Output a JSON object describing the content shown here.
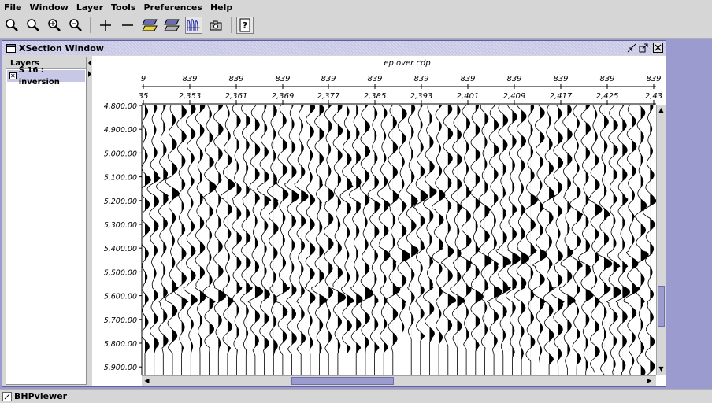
{
  "menubar": {
    "items": [
      "File",
      "Window",
      "Layer",
      "Tools",
      "Preferences",
      "Help"
    ]
  },
  "toolbar": {
    "buttons": [
      {
        "name": "zoom-reset-icon"
      },
      {
        "name": "zoom-icon"
      },
      {
        "name": "zoom-in-icon"
      },
      {
        "name": "zoom-out-icon"
      },
      {
        "name": "plus-icon"
      },
      {
        "name": "minus-icon"
      },
      {
        "name": "layer-yellow-icon"
      },
      {
        "name": "layer-gray-icon"
      },
      {
        "name": "wiggle-display-icon"
      },
      {
        "name": "camera-icon"
      },
      {
        "name": "help-icon",
        "label": "?"
      }
    ]
  },
  "xsection": {
    "title": "XSection Window",
    "layers_header": "Layers",
    "layer_item": "S 16 : inversion",
    "axis_title": "ep over cdp",
    "ep_labels": [
      "9",
      "839",
      "839",
      "839",
      "839",
      "839",
      "839",
      "839",
      "839",
      "839",
      "839",
      "839"
    ],
    "cdp_labels": [
      "35",
      "2,353",
      "2,361",
      "2,369",
      "2,377",
      "2,385",
      "2,393",
      "2,401",
      "2,409",
      "2,417",
      "2,425",
      "2,43"
    ],
    "time_labels": [
      "4,800.00",
      "4,900.00",
      "5,000.00",
      "5,100.00",
      "5,200.00",
      "5,300.00",
      "5,400.00",
      "5,500.00",
      "5,600.00",
      "5,700.00",
      "5,800.00",
      "5,900.00"
    ]
  },
  "statusbar": {
    "app_name": "BHPviewer"
  },
  "colors": {
    "accent": "#9b9bd0",
    "panel": "#d6d6d6",
    "title_bar": "#c7c7e6",
    "selection": "#c7c7e6"
  }
}
